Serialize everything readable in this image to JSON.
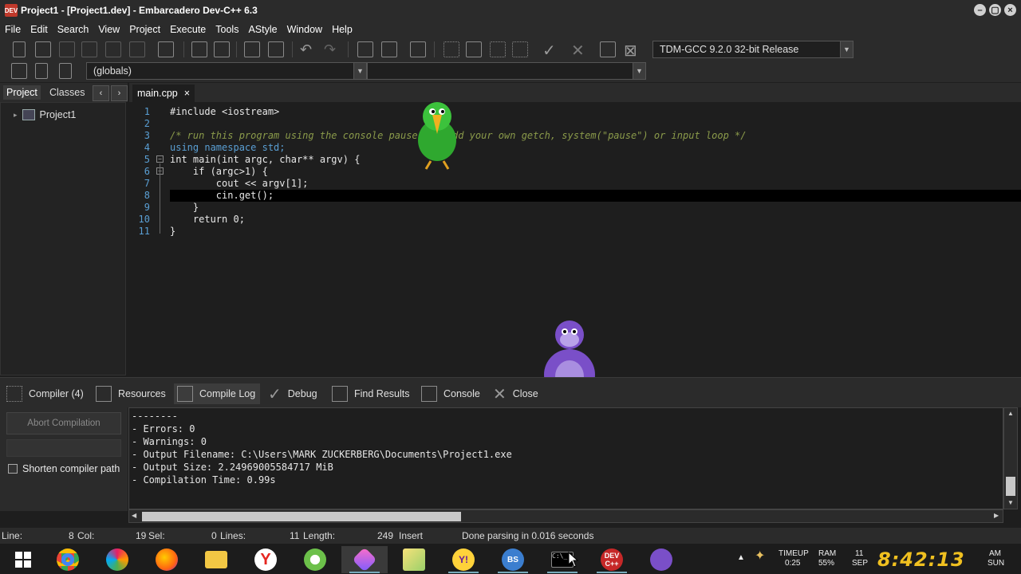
{
  "window": {
    "title": "Project1 - [Project1.dev] - Embarcadero Dev-C++ 6.3",
    "app_icon_text": "DEV"
  },
  "menu": [
    "File",
    "Edit",
    "Search",
    "View",
    "Project",
    "Execute",
    "Tools",
    "AStyle",
    "Window",
    "Help"
  ],
  "toolbar": {
    "compiler_select": "TDM-GCC 9.2.0 32-bit Release",
    "scope_select": "(globals)",
    "member_select": ""
  },
  "left_panel": {
    "tabs": [
      "Project",
      "Classes"
    ],
    "prev_label": "‹",
    "next_label": "›",
    "tree_root": "Project1"
  },
  "editor": {
    "tab_label": "main.cpp",
    "tab_close": "×",
    "lines": [
      {
        "num": "1",
        "text": "#include <iostream>"
      },
      {
        "num": "2",
        "text": ""
      },
      {
        "num": "3",
        "text": "/* run this program using the console pauser or add your own getch, system(\"pause\") or input loop */"
      },
      {
        "num": "4",
        "text": "using namespace std;"
      },
      {
        "num": "5",
        "text": "int main(int argc, char** argv) {"
      },
      {
        "num": "6",
        "text": "    if (argc>1) {"
      },
      {
        "num": "7",
        "text": "        cout << argv[1];"
      },
      {
        "num": "8",
        "text": "        cin.get();"
      },
      {
        "num": "9",
        "text": "    }"
      },
      {
        "num": "10",
        "text": "    return 0;"
      },
      {
        "num": "11",
        "text": "}"
      }
    ]
  },
  "bottom_tabs": [
    "Compiler (4)",
    "Resources",
    "Compile Log",
    "Debug",
    "Find Results",
    "Console",
    "Close"
  ],
  "compile_panel": {
    "abort_label": "Abort Compilation",
    "shorten_label": "Shorten compiler path",
    "log": "--------\n- Errors: 0\n- Warnings: 0\n- Output Filename: C:\\Users\\MARK ZUCKERBERG\\Documents\\Project1.exe\n- Output Size: 2.24969005584717 MiB\n- Compilation Time: 0.99s"
  },
  "status": {
    "line_label": "Line:",
    "line_value": "8",
    "col_label": "Col:",
    "col_value": "19",
    "sel_label": "Sel:",
    "sel_value": "0",
    "lines_label": "Lines:",
    "lines_value": "11",
    "length_label": "Length:",
    "length_value": "249",
    "mode": "Insert",
    "message": "Done parsing in 0.016 seconds"
  },
  "taskbar": {
    "timeup_label": "TIMEUP",
    "timeup_value": "0:25",
    "ram_label": "RAM",
    "ram_value": "55%",
    "date_day": "11",
    "date_month": "SEP",
    "clock": "8:42:13",
    "ampm": "AM",
    "weekday": "SUN",
    "cmd_label": "C:\\_",
    "dev_label_1": "DEV",
    "dev_label_2": "C++",
    "bs_label": "BS",
    "chat_label": "Y!"
  },
  "colors": {
    "keyword": "#5a9fd4",
    "comment": "#8a9a4a",
    "clock": "#f0c020"
  }
}
